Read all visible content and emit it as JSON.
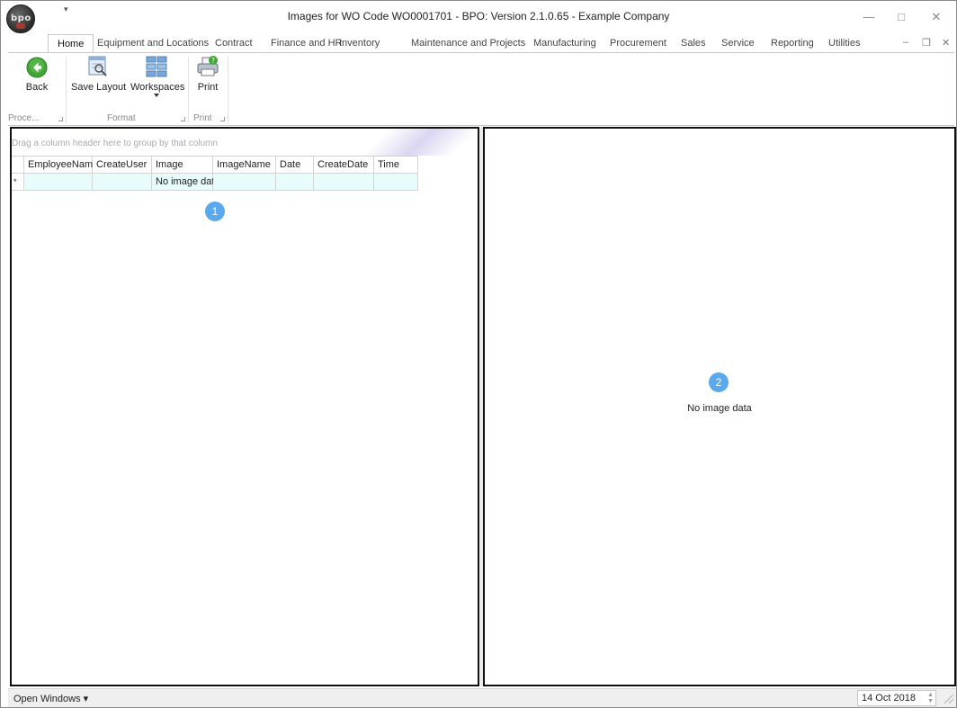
{
  "window": {
    "title": "Images for WO Code WO0001701 - BPO: Version 2.1.0.65 - Example Company",
    "logo_text": "bpo",
    "minimize_glyph": "—",
    "maximize_glyph": "□",
    "close_glyph": "✕",
    "qat_glyph": "▾"
  },
  "ribbon_tabs": [
    {
      "label": "Home",
      "active": true
    },
    {
      "label": "Equipment and Locations"
    },
    {
      "label": "Contract"
    },
    {
      "label": "Finance and HR"
    },
    {
      "label": "Inventory"
    },
    {
      "label": "Maintenance and Projects"
    },
    {
      "label": "Manufacturing"
    },
    {
      "label": "Procurement"
    },
    {
      "label": "Sales"
    },
    {
      "label": "Service"
    },
    {
      "label": "Reporting"
    },
    {
      "label": "Utilities"
    }
  ],
  "mdi_controls": {
    "minimize": "–",
    "restore": "❐",
    "close": "✕"
  },
  "ribbon": {
    "buttons": {
      "back": "Back",
      "save_layout": "Save Layout",
      "workspaces": "Workspaces",
      "print": "Print"
    },
    "groups": {
      "process": "Proce...",
      "format": "Format",
      "print": "Print"
    }
  },
  "grid": {
    "group_hint": "Drag a column header here to group by that column",
    "columns": [
      "EmployeeName",
      "CreateUser",
      "Image",
      "ImageName",
      "Date",
      "CreateDate",
      "Time"
    ],
    "new_row": [
      "",
      "",
      "No image data",
      "",
      "",
      "",
      ""
    ],
    "row_indicator": "*"
  },
  "markers": {
    "one": "1",
    "two": "2"
  },
  "preview": {
    "empty_text": "No image data"
  },
  "statusbar": {
    "open_windows": "Open Windows ▾",
    "date": "14 Oct 2018"
  },
  "colors": {
    "accent_green": "#3fa535",
    "marker_blue": "#5aa9ec",
    "new_row_bg": "#e8fcfc"
  },
  "icons": {
    "back": "back-arrow-icon",
    "save_layout": "save-layout-icon",
    "workspaces": "workspaces-icon",
    "print": "print-icon"
  }
}
